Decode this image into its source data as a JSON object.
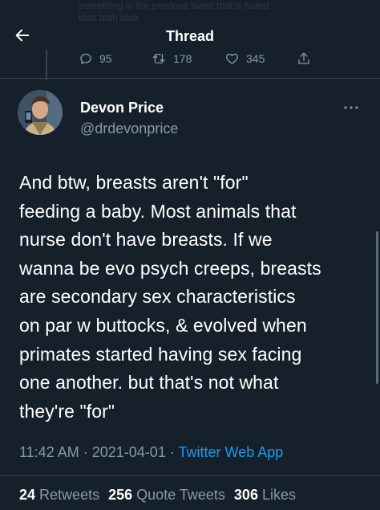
{
  "header": {
    "title": "Thread"
  },
  "previous_tweet": {
    "text_line_1": "something in the previous tweet that is faded",
    "text_line_2": "blah blah blah",
    "replies": "95",
    "retweets": "178",
    "likes": "345"
  },
  "tweet": {
    "author_name": "Devon Price",
    "author_handle": "@drdevonprice",
    "lines": [
      "And btw, breasts aren't \"for\"",
      "feeding a baby. Most animals that",
      "nurse don't have breasts. If we",
      "wanna be evo psych creeps, breasts",
      "are secondary sex characteristics",
      "on par w buttocks, & evolved when",
      "primates started having sex facing",
      "one another. but that's not what",
      "they're \"for\""
    ],
    "time": "11:42 AM",
    "separator": "·",
    "date": "2021-04-01",
    "source": "Twitter Web App"
  },
  "stats": {
    "retweets_count": "24",
    "retweets_label": "Retweets",
    "quote_count": "256",
    "quote_label": "Quote Tweets",
    "likes_count": "306",
    "likes_label": "Likes"
  },
  "icons": {
    "back": "back-arrow-icon",
    "reply": "reply-icon",
    "retweet": "retweet-icon",
    "like": "heart-icon",
    "share": "share-icon",
    "more": "more-icon"
  },
  "colors": {
    "background": "#15202b",
    "secondary_text": "#8899a6",
    "link": "#1d9bf0",
    "divider": "#38444d"
  }
}
